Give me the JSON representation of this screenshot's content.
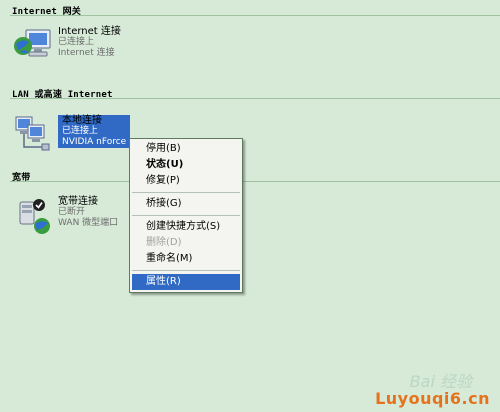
{
  "groups": [
    {
      "title": "Internet 网关"
    },
    {
      "title": "LAN 或高速 Internet"
    },
    {
      "title": "宽带"
    }
  ],
  "items": {
    "gateway": {
      "name": "Internet 连接",
      "status": "已连接上",
      "device": "Internet 连接",
      "icon": "network-globe-icon"
    },
    "lan": {
      "name": "本地连接",
      "status": "已连接上",
      "device": "NVIDIA nForce",
      "icon": "network-computers-icon"
    },
    "broadband": {
      "name": "宽带连接",
      "status": "已断开",
      "device": "WAN 微型端口",
      "icon": "broadband-globe-icon"
    }
  },
  "context_menu": {
    "items": [
      {
        "label": "停用(B)",
        "state": "normal"
      },
      {
        "label": "状态(U)",
        "state": "bold"
      },
      {
        "label": "修复(P)",
        "state": "normal"
      },
      {
        "label": "桥接(G)",
        "state": "normal"
      },
      {
        "label": "创建快捷方式(S)",
        "state": "normal"
      },
      {
        "label": "删除(D)",
        "state": "disabled"
      },
      {
        "label": "重命名(M)",
        "state": "normal"
      },
      {
        "label": "属性(R)",
        "state": "highlight"
      }
    ]
  },
  "watermark": {
    "top": "Bai 经验",
    "bottom": "Luyouqi6.cn"
  },
  "colors": {
    "background": "#d6ead7",
    "selection": "#316ac5",
    "menu_bg": "#f4f5f0"
  }
}
